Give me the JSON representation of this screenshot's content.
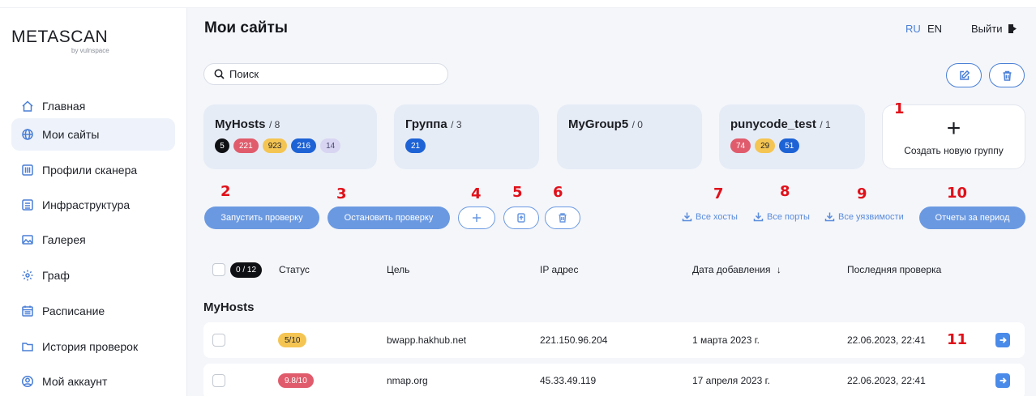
{
  "app": {
    "logo": "METASCAN",
    "logo_sub": "by vulnspace"
  },
  "sidebar": {
    "items": [
      {
        "label": "Главная",
        "icon": "home-icon",
        "active": false
      },
      {
        "label": "Мои сайты",
        "icon": "globe-icon",
        "active": true
      },
      {
        "label": "Профили сканера",
        "icon": "sliders-icon",
        "active": false
      },
      {
        "label": "Инфраструктура",
        "icon": "server-icon",
        "active": false
      },
      {
        "label": "Галерея",
        "icon": "image-icon",
        "active": false
      },
      {
        "label": "Граф",
        "icon": "graph-icon",
        "active": false
      },
      {
        "label": "Расписание",
        "icon": "calendar-icon",
        "active": false
      },
      {
        "label": "История проверок",
        "icon": "folder-icon",
        "active": false
      },
      {
        "label": "Мой аккаунт",
        "icon": "user-icon",
        "active": false
      }
    ]
  },
  "header": {
    "title": "Мои сайты",
    "lang_ru": "RU",
    "lang_en": "EN",
    "active_lang": "RU",
    "logout": "Выйти"
  },
  "search": {
    "placeholder": "Поиск"
  },
  "groups": [
    {
      "name": "MyHosts",
      "count": "/ 8",
      "badges": [
        {
          "value": "5",
          "color": "black"
        },
        {
          "value": "221",
          "color": "red"
        },
        {
          "value": "923",
          "color": "yellow"
        },
        {
          "value": "216",
          "color": "blue"
        },
        {
          "value": "14",
          "color": "lilac"
        }
      ]
    },
    {
      "name": "Группа",
      "count": "/ 3",
      "badges": [
        {
          "value": "21",
          "color": "blue"
        }
      ]
    },
    {
      "name": "MyGroup5",
      "count": "/ 0",
      "badges": []
    },
    {
      "name": "punycode_test",
      "count": "/ 1",
      "badges": [
        {
          "value": "74",
          "color": "red"
        },
        {
          "value": "29",
          "color": "yellow"
        },
        {
          "value": "51",
          "color": "blue"
        }
      ]
    }
  ],
  "new_group": {
    "plus": "+",
    "label": "Создать новую группу"
  },
  "actions": {
    "start_scan": "Запустить проверку",
    "stop_scan": "Остановить проверку",
    "all_hosts": "Все хосты",
    "all_ports": "Все порты",
    "all_vulns": "Все уязвимости",
    "period_reports": "Отчеты за период"
  },
  "markers": [
    "1",
    "2",
    "3",
    "4",
    "5",
    "6",
    "7",
    "8",
    "9",
    "10",
    "11"
  ],
  "table": {
    "selected_counter": "0 / 12",
    "headers": {
      "status": "Статус",
      "target": "Цель",
      "ip": "IP адрес",
      "added": "Дата добавления",
      "last_scan": "Последняя проверка"
    },
    "sort_arrow": "↓",
    "group_label": "MyHosts",
    "rows": [
      {
        "status": "5/10",
        "status_color": "yellow",
        "target": "bwapp.hakhub.net",
        "ip": "221.150.96.204",
        "added": "1 марта 2023 г.",
        "last_scan": "22.06.2023, 22:41"
      },
      {
        "status": "9.8/10",
        "status_color": "red",
        "target": "nmap.org",
        "ip": "45.33.49.119",
        "added": "17 апреля 2023 г.",
        "last_scan": "22.06.2023, 22:41"
      }
    ]
  },
  "colors": {
    "accent": "#4a7fd6",
    "button": "#6b99e1",
    "marker": "#e0101a",
    "card_bg": "#e6ecf6"
  }
}
